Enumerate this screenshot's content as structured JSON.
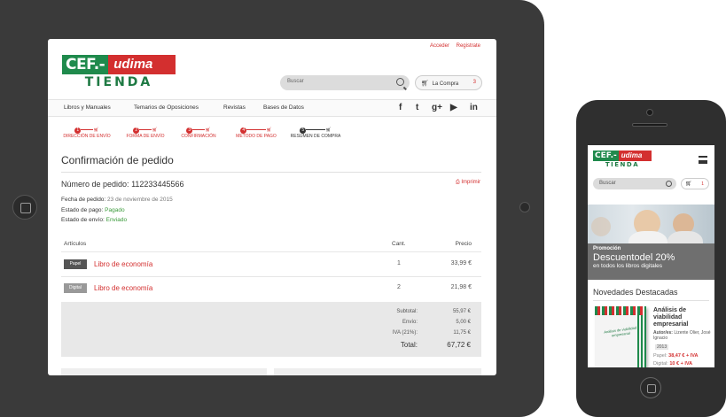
{
  "tablet": {
    "top_links": {
      "login": "Acceder",
      "register": "Registrate"
    },
    "logo": {
      "brand_left": "CEF.-",
      "brand_right": "udima",
      "subtitle": "TIENDA"
    },
    "search": {
      "placeholder": "Buscar"
    },
    "cart": {
      "label": "La Compra",
      "count": "3"
    },
    "nav": [
      "Libros y Manuales",
      "Temarios de Oposiciones",
      "Revistas",
      "Bases de Datos"
    ],
    "social_icons": [
      "facebook-icon",
      "twitter-icon",
      "google-plus-icon",
      "youtube-icon",
      "linkedin-icon"
    ],
    "social_glyphs": [
      "f",
      "t",
      "g+",
      "▶",
      "in"
    ],
    "steps": [
      {
        "num": "1",
        "label": "DIRECCIÓN DE ENVÍO"
      },
      {
        "num": "2",
        "label": "FORMA DE ENVÍO"
      },
      {
        "num": "3",
        "label": "CONFIRMACIÓN"
      },
      {
        "num": "4",
        "label": "MÉTODO DE PAGO"
      },
      {
        "num": "5",
        "label": "RESUMEN DE COMPRA"
      }
    ],
    "page_title": "Confirmación de pedido",
    "order": {
      "number_label": "Número de pedido:",
      "number": "112233445566",
      "print": "Imprimir",
      "date_label": "Fecha de pedido:",
      "date": "23 de noviembre de 2015",
      "payment_label": "Estado de pago:",
      "payment": "Pagado",
      "shipping_label": "Estado de envío:",
      "shipping": "Enviado"
    },
    "table": {
      "headers": {
        "item": "Artículos",
        "qty": "Cant.",
        "price": "Precio"
      },
      "rows": [
        {
          "tag": "Papel",
          "title": "Libro de economía",
          "qty": "1",
          "price": "33,99 €"
        },
        {
          "tag": "Digital",
          "title": "Libro de economía",
          "qty": "2",
          "price": "21,98 €"
        }
      ]
    },
    "totals": {
      "subtotal_label": "Subtotal:",
      "subtotal": "55,97 €",
      "shipping_label": "Envío:",
      "shipping": "5,00 €",
      "vat_label": "IVA (21%):",
      "vat": "11,75 €",
      "total_label": "Total:",
      "total": "67,72 €"
    },
    "colors": {
      "brand_green": "#1f8a4c",
      "brand_red": "#d32f2f",
      "status_ok": "#3a9a3a"
    }
  },
  "phone": {
    "logo": {
      "brand_left": "CEF.-",
      "brand_right": "udima",
      "subtitle": "TIENDA"
    },
    "search": {
      "placeholder": "Buscar"
    },
    "cart": {
      "count": "1"
    },
    "promo": {
      "kicker": "Promoción",
      "title": "Descuentodel 20%",
      "subtitle": "en todos los libros digitales"
    },
    "section_title": "Novedades Destacadas",
    "book": {
      "cover_text": "Análisis de viabilidad empresarial",
      "title": "Análisis de viabilidad empresarial",
      "author_label": "Autor/es:",
      "author": "Lizente Olier, José Ignacio",
      "year": "2013",
      "paper_label": "Papel:",
      "paper_price": "38,47 € + IVA",
      "digital_label": "Digital:",
      "digital_price": "10 € + IVA"
    }
  }
}
